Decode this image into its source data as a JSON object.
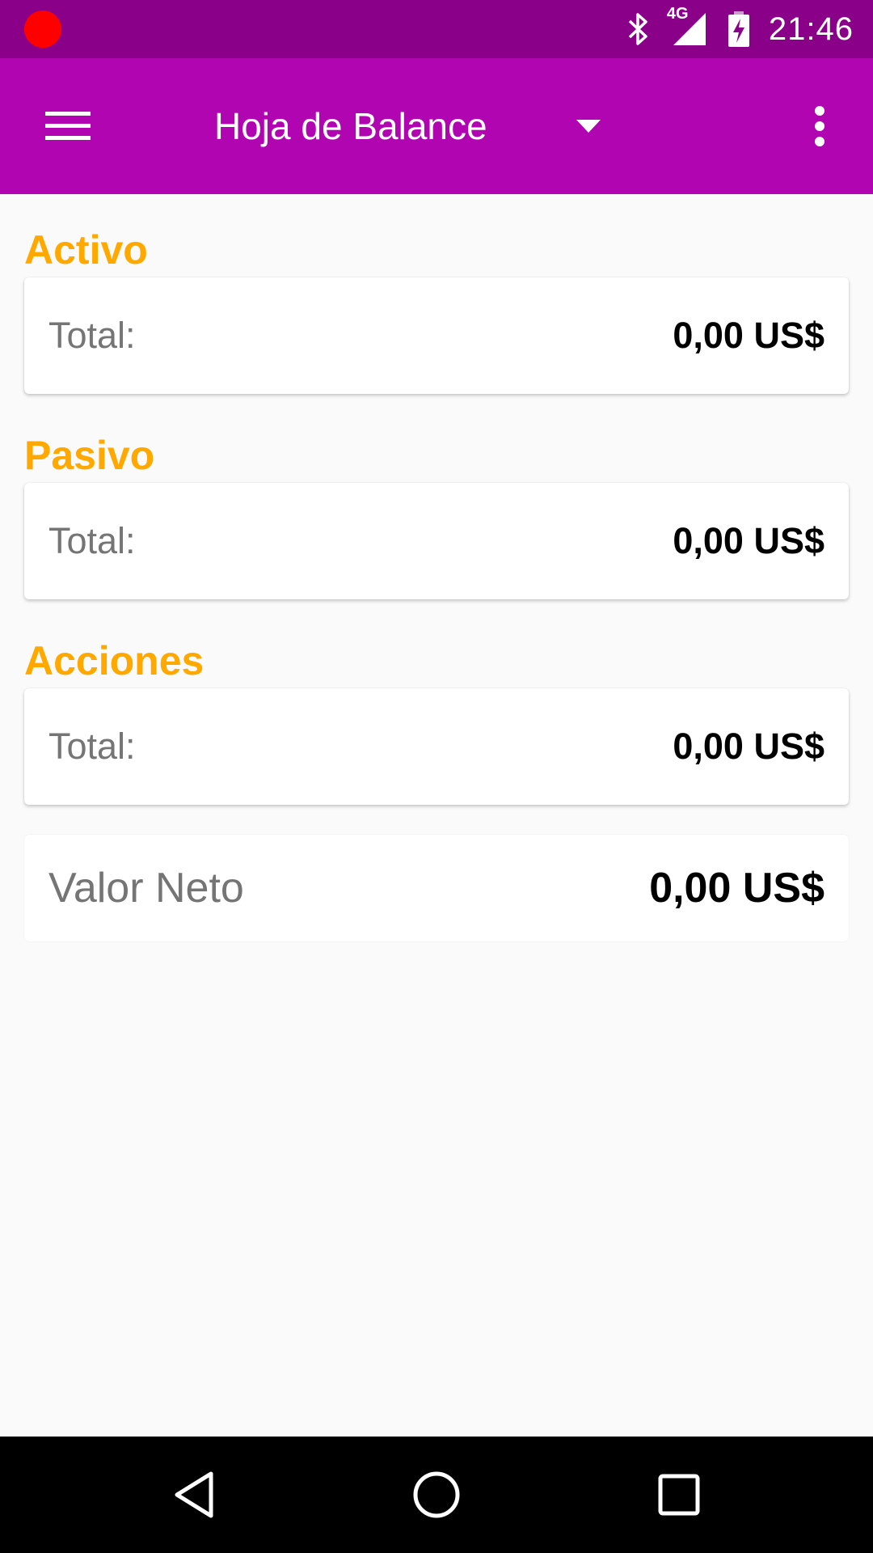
{
  "status_bar": {
    "time": "21:46",
    "network": "4G",
    "icons": [
      "recording-dot-icon",
      "bluetooth-icon",
      "cellular-signal-icon",
      "battery-charging-icon"
    ],
    "colors": {
      "background": "#8b0088",
      "record_dot": "#ff0000"
    }
  },
  "app_bar": {
    "title": "Hoja de Balance",
    "icons": [
      "hamburger-menu-icon",
      "dropdown-arrow-icon",
      "overflow-menu-icon"
    ],
    "colors": {
      "background": "#b005b0"
    }
  },
  "sections": [
    {
      "title": "Activo",
      "label": "Total:",
      "value": "0,00 US$"
    },
    {
      "title": "Pasivo",
      "label": "Total:",
      "value": "0,00 US$"
    },
    {
      "title": "Acciones",
      "label": "Total:",
      "value": "0,00 US$"
    }
  ],
  "net_worth": {
    "label": "Valor Neto",
    "value": "0,00 US$"
  },
  "nav_bar": {
    "icons": [
      "back-icon",
      "home-icon",
      "recents-icon"
    ]
  },
  "colors": {
    "section_title": "#ffa800",
    "background": "#fafafa"
  }
}
